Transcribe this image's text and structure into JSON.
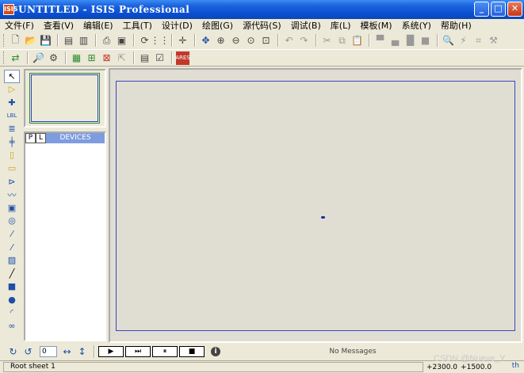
{
  "window": {
    "title": "UNTITLED - ISIS Professional",
    "app_icon_label": "ISIS"
  },
  "menu": [
    "文件(F)",
    "查看(V)",
    "编辑(E)",
    "工具(T)",
    "设计(D)",
    "绘图(G)",
    "源代码(S)",
    "调试(B)",
    "库(L)",
    "模板(M)",
    "系统(Y)",
    "帮助(H)"
  ],
  "toolbar_icons": [
    "new-file-icon",
    "open-folder-icon",
    "save-icon",
    "import-icon",
    "export-icon",
    "print-icon",
    "print-area-icon",
    "refresh-icon",
    "grid-icon",
    "origin-icon",
    "pan-icon",
    "zoom-in-icon",
    "zoom-out-icon",
    "zoom-all-icon",
    "zoom-area-icon",
    "undo-icon",
    "redo-icon",
    "cut-icon",
    "copy-icon",
    "paste-icon",
    "block-copy-icon",
    "block-move-icon",
    "block-rotate-icon",
    "block-delete-icon",
    "pick-device-icon",
    "make-device-icon",
    "packaging-icon",
    "decompose-icon"
  ],
  "toolbar2_icons": [
    "wire-autorouter-icon",
    "search-icon",
    "property-tool-icon",
    "design-explorer-icon",
    "new-sheet-icon",
    "delete-sheet-icon",
    "exit-to-parent-icon",
    "bom-icon",
    "erc-icon",
    "netlist-icon",
    "ares-icon"
  ],
  "tool_strip": [
    "selection-icon",
    "component-icon",
    "junction-icon",
    "wire-label-icon",
    "text-script-icon",
    "bus-icon",
    "subcircuit-icon",
    "terminal-icon",
    "device-pin-icon",
    "graph-icon",
    "tape-recorder-icon",
    "generator-icon",
    "voltage-probe-icon",
    "current-probe-icon",
    "virtual-instrument-icon",
    "line-icon",
    "box-icon",
    "circle-icon",
    "arc-icon",
    "path-icon"
  ],
  "device_panel": {
    "p_label": "P",
    "l_label": "L",
    "title": "DEVICES"
  },
  "controls": {
    "rotation_value": "0",
    "messages": "No Messages"
  },
  "status": {
    "sheet": "Root sheet 1",
    "x": "+2300.0",
    "y": "+1500.0",
    "unit": "th"
  },
  "watermark": "CSDN @Nueve_Y"
}
